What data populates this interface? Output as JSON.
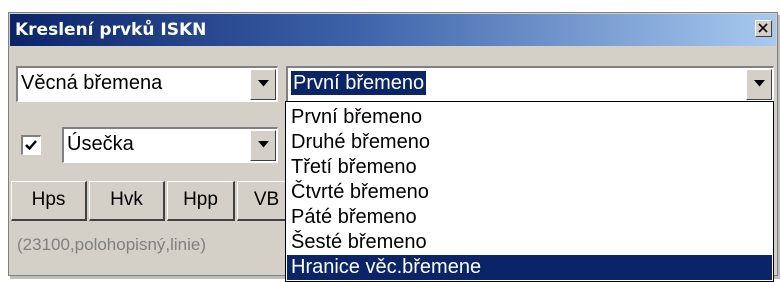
{
  "window": {
    "title": "Kreslení prvků ISKN"
  },
  "layer_combo": {
    "value": "Věcná břemena"
  },
  "item_combo": {
    "value": "První břemeno"
  },
  "draw_checkbox": {
    "checked": true
  },
  "shape_combo": {
    "value": "Úsečka"
  },
  "toolbar": {
    "buttons": [
      "Hps",
      "Hvk",
      "Hpp",
      "VB"
    ]
  },
  "status": {
    "text": "(23100,polohopisný,linie)"
  },
  "dropdown": {
    "items": [
      "První břemeno",
      "Druhé břemeno",
      "Třetí břemeno",
      "Čtvrté břemeno",
      "Páté břemeno",
      "Šesté břemeno",
      "Hranice věc.břemene"
    ],
    "highlighted_index": 6
  },
  "colors": {
    "title_start": "#0a246a",
    "title_end": "#a6caf0",
    "selection": "#0a246a",
    "face": "#d4d0c8",
    "status_text": "#808080"
  }
}
